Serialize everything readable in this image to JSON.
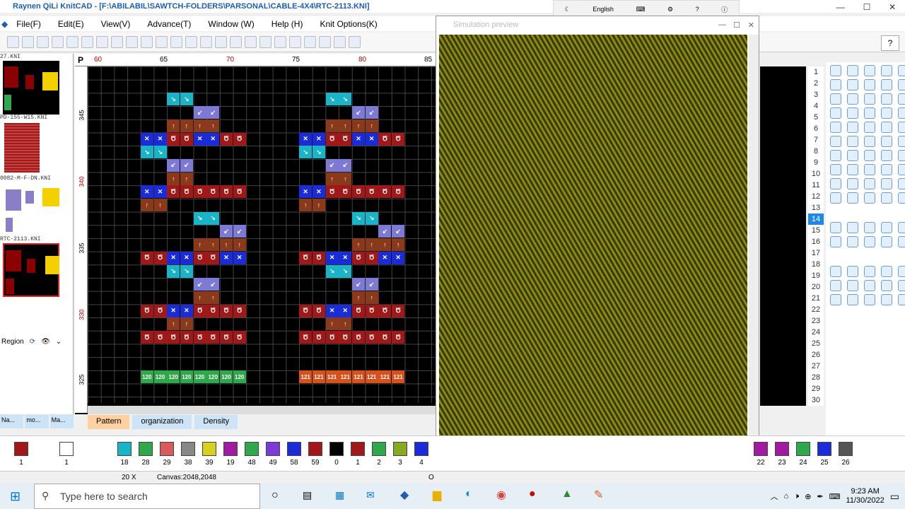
{
  "app": {
    "title": "Raynen QiLi KnitCAD - [F:\\ABILABIL\\SAWTCH-FOLDERS\\PARSONAL\\CABLE-4X4\\RTC-2113.KNI]"
  },
  "ime": {
    "language": "English"
  },
  "menu": [
    "File(F)",
    "Edit(E)",
    "View(V)",
    "Advance(T)",
    "Window (W)",
    "Help (H)",
    "Knit Options(K)"
  ],
  "left_panel": {
    "files": [
      "27.KNI",
      "PD-155-W15.KNI",
      "0082-M-F-DN.KNI",
      "RTC-2113.KNI"
    ],
    "region_label": "Region",
    "tabs": [
      "Na...",
      "mo...",
      "Ma..."
    ]
  },
  "editor": {
    "ruler_top": [
      "60",
      "65",
      "70",
      "75",
      "80",
      "85"
    ],
    "ruler_left": [
      "345",
      "340",
      "335",
      "330",
      "325"
    ],
    "row_labels_left": "120",
    "row_labels_right": "121",
    "p_label": "P"
  },
  "tabs": [
    "Pattern",
    "organization",
    "Density"
  ],
  "simulation": {
    "title": "Simulation preview"
  },
  "right_numbers": [
    "1",
    "2",
    "3",
    "4",
    "5",
    "6",
    "7",
    "8",
    "9",
    "10",
    "11",
    "12",
    "13",
    "14",
    "15",
    "16",
    "17",
    "18",
    "19",
    "20",
    "21",
    "22",
    "23",
    "24",
    "25",
    "26",
    "27",
    "28",
    "29",
    "30"
  ],
  "selected_right_number": "14",
  "palette": {
    "left_items": [
      "1",
      "1"
    ],
    "items": [
      "18",
      "28",
      "29",
      "38",
      "39",
      "19",
      "48",
      "49",
      "58",
      "59",
      "0",
      "1",
      "2",
      "3",
      "4"
    ],
    "right_items": [
      "22",
      "23",
      "24",
      "25",
      "26"
    ]
  },
  "status": {
    "zoom": "20 X",
    "canvas": "Canvas:2048,2048",
    "o": "O"
  },
  "taskbar": {
    "search_placeholder": "Type here to search",
    "time": "9:23 AM",
    "date": "11/30/2022"
  }
}
